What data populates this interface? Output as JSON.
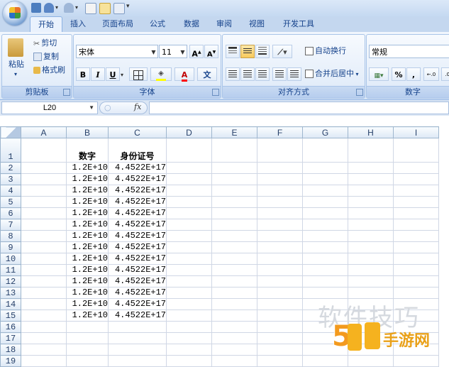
{
  "title_bar": {
    "quick_access": [
      "save-icon",
      "undo-icon",
      "redo-icon",
      "print-preview-icon",
      "open-icon",
      "customize-icon"
    ]
  },
  "tabs": [
    "开始",
    "插入",
    "页面布局",
    "公式",
    "数据",
    "审阅",
    "视图",
    "开发工具"
  ],
  "clipboard": {
    "paste": "粘贴",
    "cut": "剪切",
    "copy": "复制",
    "format_painter": "格式刷",
    "label": "剪贴板"
  },
  "font": {
    "name": "宋体",
    "size": "11",
    "grow": "A",
    "shrink": "A",
    "bold": "B",
    "italic": "I",
    "underline": "U",
    "font_color": "A",
    "phonetic": "文",
    "label": "字体"
  },
  "alignment": {
    "wrap_text": "自动换行",
    "merge_center": "合并后居中",
    "label": "对齐方式"
  },
  "number": {
    "format": "常规",
    "percent": "%",
    "comma": ",",
    "label": "数字"
  },
  "formula_bar": {
    "name_box": "L20",
    "fx": "fx",
    "formula": ""
  },
  "sheet": {
    "columns": [
      "A",
      "B",
      "C",
      "D",
      "E",
      "F",
      "G",
      "H",
      "I"
    ],
    "rows": [
      "1",
      "2",
      "3",
      "4",
      "5",
      "6",
      "7",
      "8",
      "9",
      "10",
      "11",
      "12",
      "13",
      "14",
      "15",
      "16",
      "17",
      "18",
      "19"
    ],
    "header_b": "数字",
    "header_c": "身份证号",
    "values_b": [
      "1.2E+10",
      "1.2E+10",
      "1.2E+10",
      "1.2E+10",
      "1.2E+10",
      "1.2E+10",
      "1.2E+10",
      "1.2E+10",
      "1.2E+10",
      "1.2E+10",
      "1.2E+10",
      "1.2E+10",
      "1.2E+10",
      "1.2E+10"
    ],
    "values_c": [
      "4.4522E+17",
      "4.4522E+17",
      "4.4522E+17",
      "4.4522E+17",
      "4.4522E+17",
      "4.4522E+17",
      "4.4522E+17",
      "4.4522E+17",
      "4.4522E+17",
      "4.4522E+17",
      "4.4522E+17",
      "4.4522E+17",
      "4.4522E+17",
      "4.4522E+17"
    ]
  },
  "watermark": {
    "text1": "软件技巧",
    "text2": "手游网"
  }
}
